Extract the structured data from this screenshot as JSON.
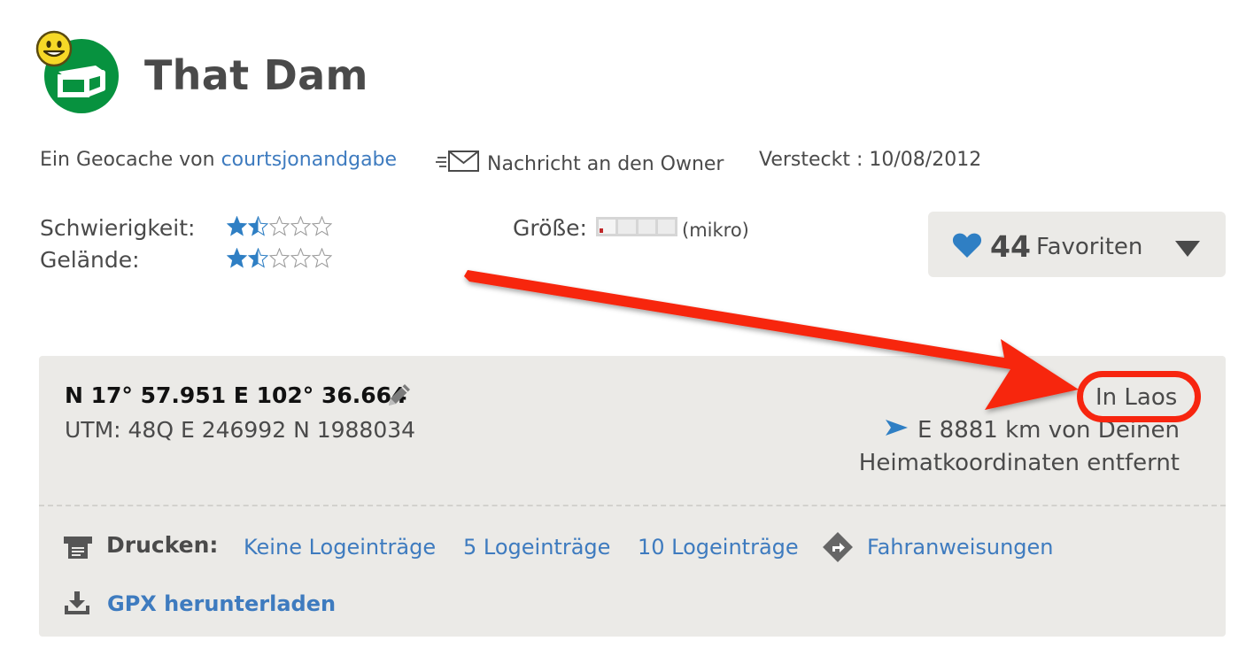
{
  "cache": {
    "name": "That Dam",
    "type_icon": "traditional-cache-icon",
    "badge_icon": "smiley-found-icon"
  },
  "meta": {
    "owner_prefix": "Ein Geocache von",
    "owner_name": "courtsjonandgabe",
    "message_label": "Nachricht an den Owner",
    "message_icon": "envelope-icon",
    "hidden_label": "Versteckt : 10/08/2012"
  },
  "ratings": {
    "difficulty_label": "Schwierigkeit:",
    "difficulty_value": 1.5,
    "terrain_label": "Gelände:",
    "terrain_value": 1.5,
    "max_stars": 5,
    "size_label": "Größe:",
    "size_text": "(mikro)",
    "size_level": 1,
    "size_levels": 5
  },
  "favorites": {
    "count": "44",
    "label": "Favoriten",
    "icon": "heart-icon"
  },
  "coordinates": {
    "main": "N 17° 57.951 E 102° 36.664",
    "utm": "UTM: 48Q E 246992 N 1988034",
    "country": "In Laos",
    "distance_line1": "E 8881 km von Deinen",
    "distance_line2": "Heimatkoordinaten entfernt"
  },
  "print": {
    "label": "Drucken:",
    "no_logs": "Keine Logeinträge",
    "five_logs": "5 Logeinträge",
    "ten_logs": "10 Logeinträge",
    "directions": "Fahranweisungen",
    "gpx": "GPX herunterladen"
  },
  "colors": {
    "link": "#3e7bbf",
    "accent_green": "#07923f",
    "star_blue": "#2f7fc4",
    "annotation_red": "#f7250f",
    "panel_bg": "#ebeae7"
  }
}
